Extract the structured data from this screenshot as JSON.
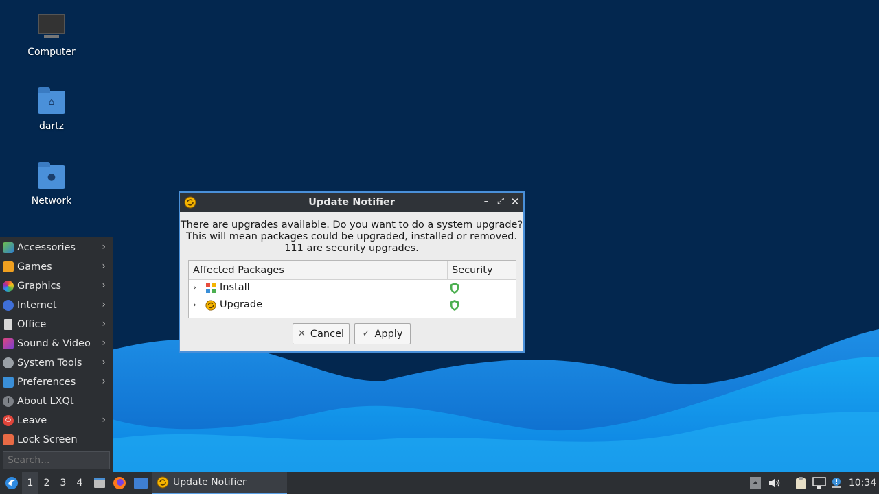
{
  "desktop": {
    "icons": [
      {
        "label": "Computer"
      },
      {
        "label": "dartz"
      },
      {
        "label": "Network"
      }
    ]
  },
  "start_menu": {
    "items": [
      {
        "label": "Accessories",
        "has_submenu": true,
        "icon": "accessories-icon"
      },
      {
        "label": "Games",
        "has_submenu": true,
        "icon": "games-icon"
      },
      {
        "label": "Graphics",
        "has_submenu": true,
        "icon": "graphics-icon"
      },
      {
        "label": "Internet",
        "has_submenu": true,
        "icon": "internet-icon"
      },
      {
        "label": "Office",
        "has_submenu": true,
        "icon": "office-icon"
      },
      {
        "label": "Sound & Video",
        "has_submenu": true,
        "icon": "sound-video-icon"
      },
      {
        "label": "System Tools",
        "has_submenu": true,
        "icon": "system-tools-icon"
      },
      {
        "label": "Preferences",
        "has_submenu": true,
        "icon": "preferences-icon"
      },
      {
        "label": "About LXQt",
        "has_submenu": false,
        "icon": "info-icon"
      },
      {
        "label": "Leave",
        "has_submenu": true,
        "icon": "power-icon"
      },
      {
        "label": "Lock Screen",
        "has_submenu": false,
        "icon": "lock-icon"
      }
    ],
    "search_placeholder": "Search...",
    "submenu_arrow": "›"
  },
  "dialog": {
    "title": "Update Notifier",
    "message_lines": [
      "There are upgrades available. Do you want to do a system upgrade?",
      "This will mean packages could be upgraded, installed or removed.",
      "111 are security upgrades."
    ],
    "table": {
      "col_packages": "Affected Packages",
      "col_security": "Security",
      "rows": [
        {
          "label": "Install"
        },
        {
          "label": "Upgrade"
        }
      ]
    },
    "cancel_label": "Cancel",
    "apply_label": "Apply"
  },
  "taskbar": {
    "desktops": [
      "1",
      "2",
      "3",
      "4"
    ],
    "active_desktop": "1",
    "window_label": "Update Notifier",
    "clock": "10:34"
  },
  "colors": {
    "accent": "#4a90d9",
    "wallpaper_dark": "#03274f",
    "panel": "#2c2f33",
    "shield_green": "#4caf50"
  }
}
